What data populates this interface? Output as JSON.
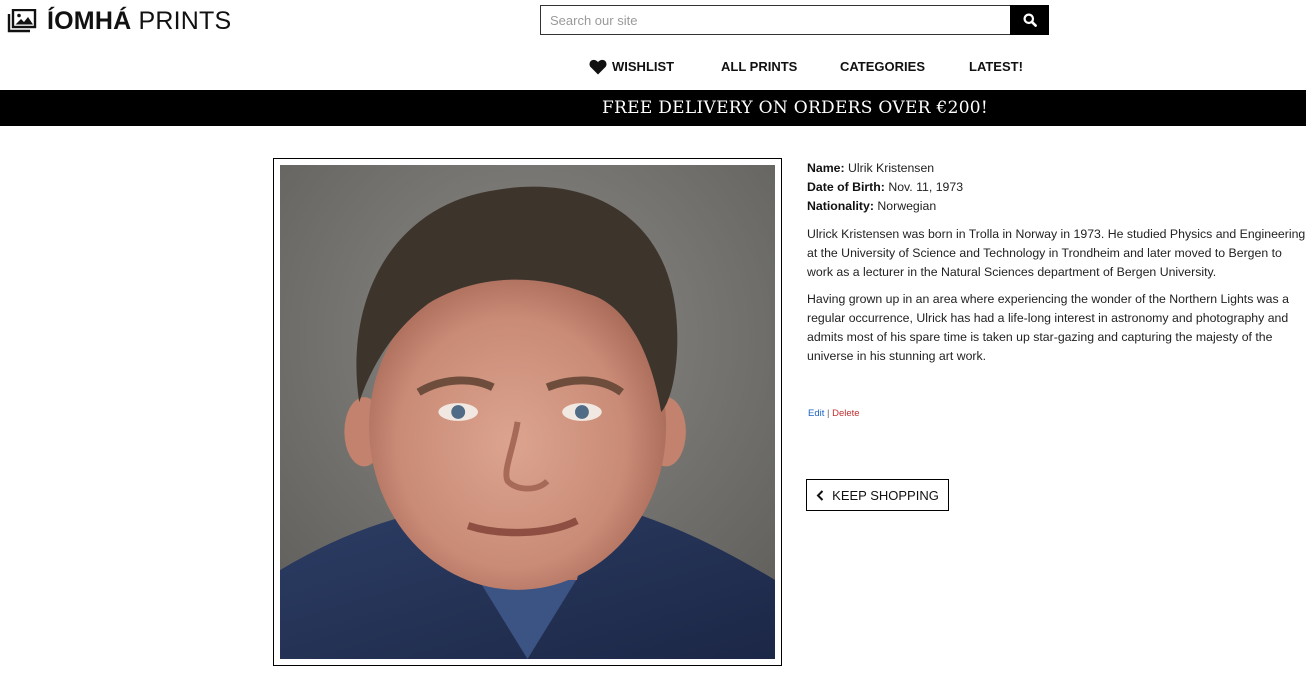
{
  "header": {
    "logo_bold": "ÍOMHÁ",
    "logo_light": "PRINTS",
    "logo_icon": "images-icon"
  },
  "search": {
    "placeholder": "Search our site",
    "icon": "search-icon"
  },
  "nav": {
    "wishlist": "WISHLIST",
    "all_prints": "ALL PRINTS",
    "categories": "CATEGORIES",
    "latest": "LATEST!"
  },
  "banner": {
    "text": "FREE DELIVERY ON ORDERS OVER €200!"
  },
  "artist": {
    "name_label": "Name:",
    "name": "Ulrik Kristensen",
    "dob_label": "Date of Birth:",
    "dob": "Nov. 11, 1973",
    "nationality_label": "Nationality:",
    "nationality": "Norwegian",
    "bio_1_lines": [
      "Ulrick Kristensen was born in Trolla in Norway in 1973. He studied Physics and Engineering",
      "at the University of Science and Technology in Trondheim and later moved to Bergen to",
      "work as a lecturer in the Natural Sciences department of Bergen University."
    ],
    "bio_2_lines": [
      "Having grown up in an area where experiencing the wonder of the Northern Lights was a",
      "regular occurrence, Ulrick has had a life-long interest in astronomy and photography and",
      "admits most of his spare time is taken up star-gazing and capturing the majesty of the",
      "universe in his stunning art work."
    ]
  },
  "admin": {
    "edit": "Edit",
    "separator": "|",
    "delete": "Delete"
  },
  "actions": {
    "keep_shopping": "KEEP SHOPPING"
  },
  "colors": {
    "banner_bg": "#000000",
    "edit_link": "#1a62c2",
    "delete_link": "#c0302f"
  }
}
